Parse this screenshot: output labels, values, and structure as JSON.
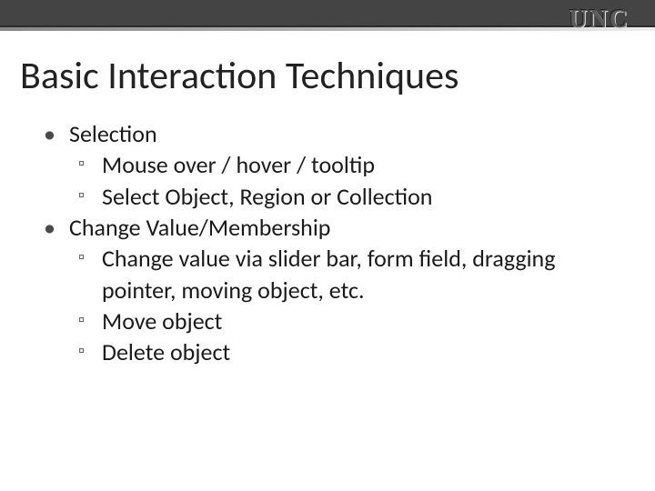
{
  "logo": "UNC",
  "title": "Basic Interaction Techniques",
  "bullets": [
    {
      "level": 1,
      "text": "Selection"
    },
    {
      "level": 2,
      "text": "Mouse over / hover / tooltip"
    },
    {
      "level": 2,
      "text": "Select Object, Region or Collection"
    },
    {
      "level": 1,
      "text": "Change Value/Membership"
    },
    {
      "level": 2,
      "text": "Change value via slider bar, form field, dragging pointer, moving object, etc."
    },
    {
      "level": 2,
      "text": "Move object"
    },
    {
      "level": 2,
      "text": "Delete object"
    }
  ]
}
